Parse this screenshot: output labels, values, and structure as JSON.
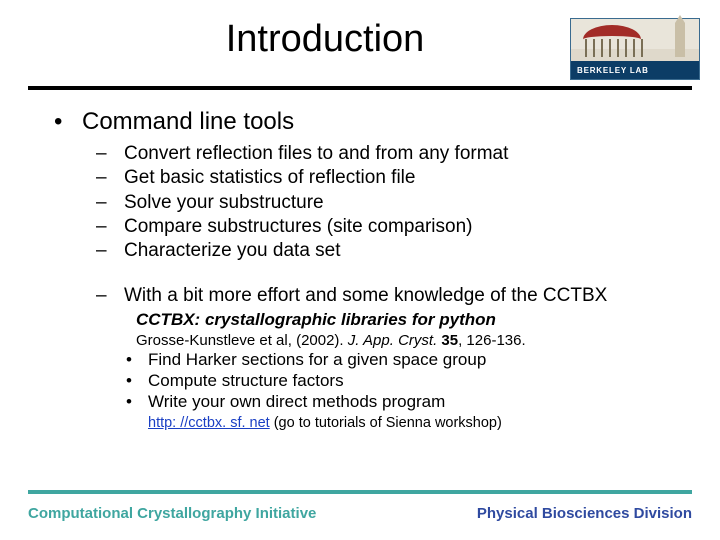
{
  "title": "Introduction",
  "logo_text": "BERKELEY LAB",
  "heading": "Command line tools",
  "sub_items": [
    "Convert reflection files to and from any format",
    "Get basic statistics of reflection file",
    "Solve your substructure",
    "Compare substructures (site comparison)",
    "Characterize you data set"
  ],
  "effort_line": "With a bit more effort and some knowledge of the CCTBX",
  "cctbx_caption": "CCTBX: crystallographic libraries for python",
  "reference": {
    "authors": "Grosse-Kunstleve et al, (2002). ",
    "journal": "J. App. Cryst. ",
    "volume": "35",
    "pages": ", 126-136."
  },
  "effort_sub": [
    "Find Harker sections for a given space group",
    "Compute structure factors",
    "Write your own direct methods program"
  ],
  "link_text": "http: //cctbx. sf. net",
  "link_suffix": " (go to tutorials of Sienna workshop)",
  "footer_left": "Computational Crystallography Initiative",
  "footer_right": "Physical Biosciences Division"
}
